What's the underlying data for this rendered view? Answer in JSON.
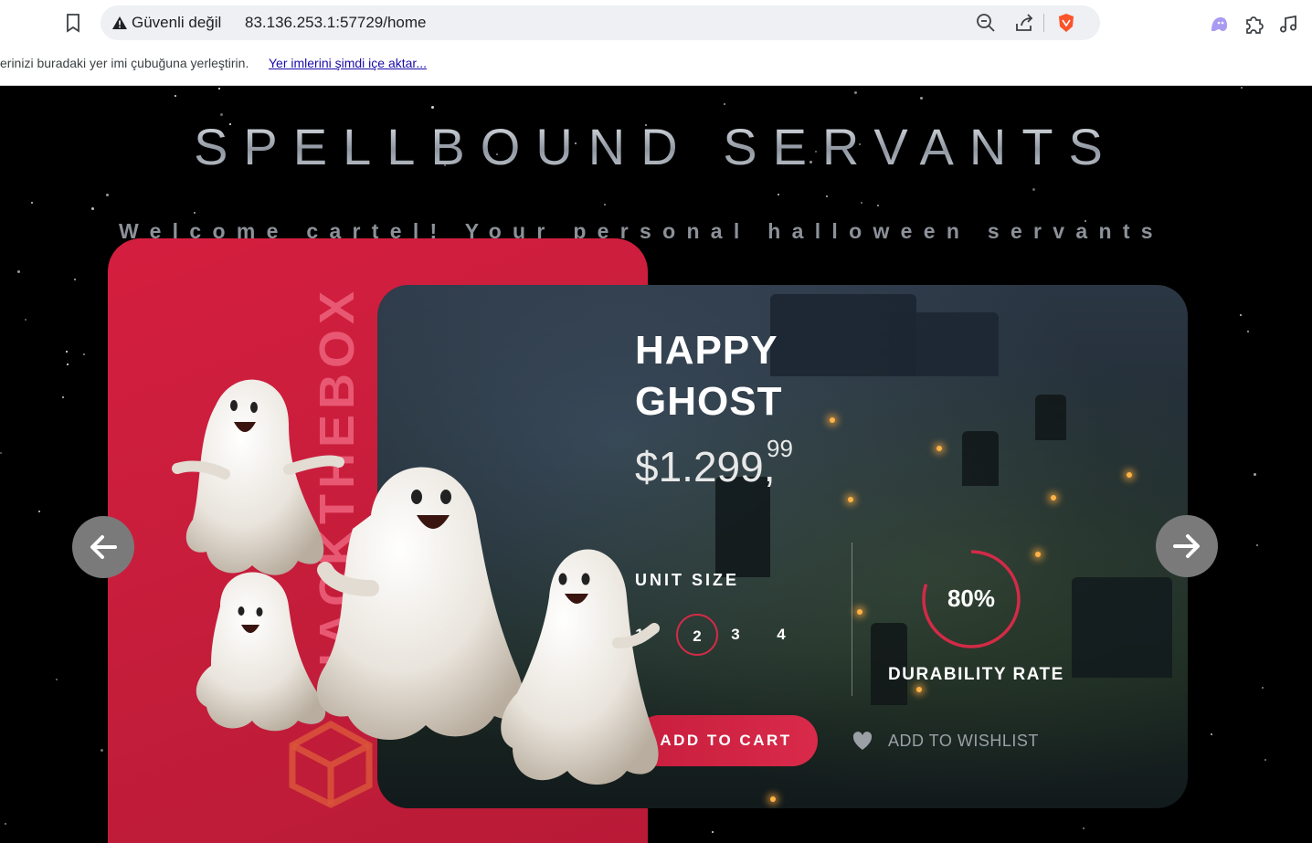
{
  "browser": {
    "security_label": "Güvenli değil",
    "url": "83.136.253.1:57729/home",
    "bookmarks_hint": "erinizi buradaki yer imi çubuğuna yerleştirin.",
    "bookmarks_import_link": "Yer imlerini şimdi içe aktar..."
  },
  "page": {
    "title": "SPELLBOUND SERVANTS",
    "subtitle": "Welcome cartel! Your personal halloween servants",
    "brand_text": "HACKTHEBOX",
    "product": {
      "name": "HAPPY GHOST",
      "price_main": "$1.299,",
      "price_cents": "99",
      "unit_size_label": "UNIT SIZE",
      "sizes": [
        "1",
        "2",
        "3",
        "4"
      ],
      "selected_size": "2",
      "durability_value": "80%",
      "durability_fraction": 0.8,
      "durability_label": "DURABILITY RATE",
      "add_to_cart_label": "ADD TO CART",
      "add_to_wishlist_label": "ADD TO WISHLIST"
    },
    "colors": {
      "accent": "#d22b47",
      "card_red": "#c81e3d"
    },
    "icons": {
      "prev": "arrow-left-icon",
      "next": "arrow-right-icon",
      "wishlist": "heart-icon"
    }
  }
}
